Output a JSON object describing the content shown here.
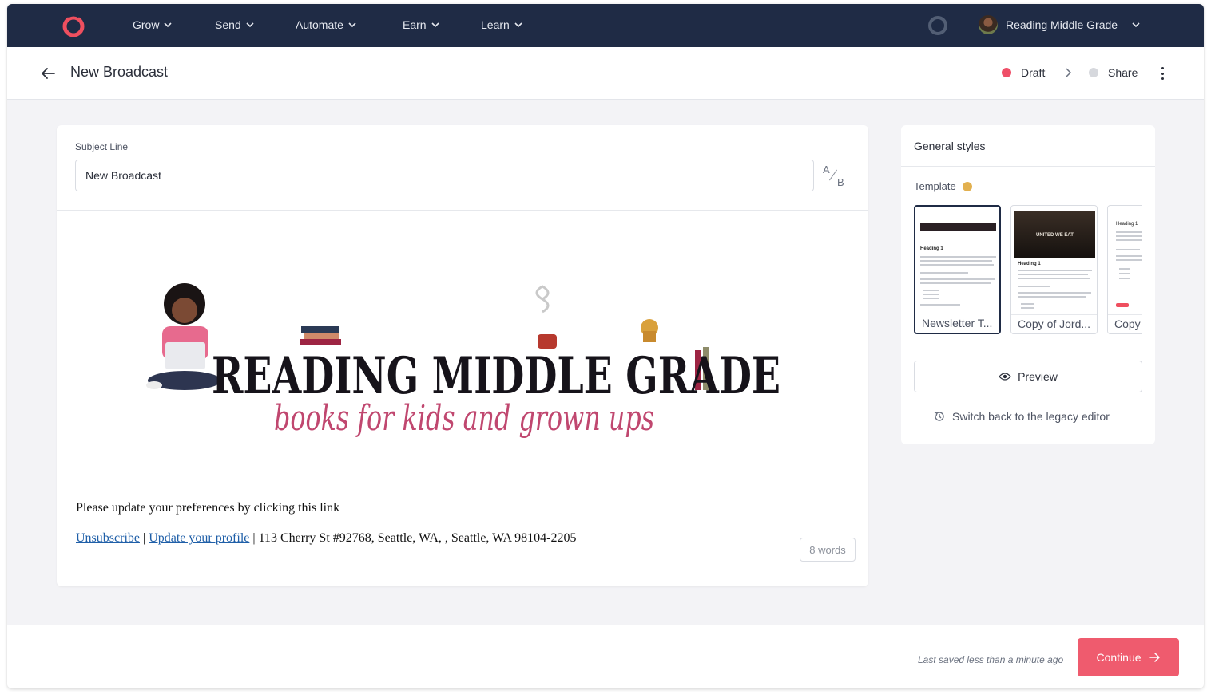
{
  "nav": {
    "items": [
      {
        "label": "Grow"
      },
      {
        "label": "Send"
      },
      {
        "label": "Automate"
      },
      {
        "label": "Earn"
      },
      {
        "label": "Learn"
      }
    ],
    "account_name": "Reading Middle Grade",
    "brand_color": "#1f2b45",
    "logo_color": "#ef4f5f"
  },
  "header": {
    "title": "New Broadcast",
    "steps": [
      {
        "label": "Draft",
        "color": "#ef4f68"
      },
      {
        "label": "Share",
        "color": "#d6d8dd"
      }
    ]
  },
  "editor": {
    "subject_label": "Subject Line",
    "subject_value": "New Broadcast",
    "ab_a": "A",
    "ab_b": "B",
    "banner": {
      "title": "READING MIDDLE GRADE",
      "tagline": "books for kids and grown ups"
    },
    "preferences_text": "Please update your preferences by clicking this link",
    "unsubscribe_link": "Unsubscribe",
    "separator": "|",
    "update_profile_link": "Update your profile",
    "address": "| 113 Cherry St #92768, Seattle, WA, , Seattle, WA 98104-2205",
    "word_count": "8 words"
  },
  "panel": {
    "title": "General styles",
    "template_label": "Template",
    "templates": [
      {
        "name": "Newsletter T...",
        "heading": "Heading 1"
      },
      {
        "name": "Copy of Jord...",
        "heading": "Heading 1",
        "hero_text": "UNITED WE EAT"
      },
      {
        "name": "Copy",
        "heading": "Heading 1"
      }
    ],
    "preview_label": "Preview",
    "legacy_label": "Switch back to the legacy editor"
  },
  "footer": {
    "saved_text": "Last saved less than a minute ago",
    "continue_label": "Continue",
    "accent": "#ef5b6e"
  }
}
